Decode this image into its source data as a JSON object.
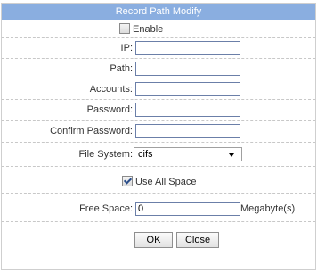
{
  "dialog": {
    "title": "Record Path Modify",
    "enable": {
      "label": "Enable",
      "checked": false
    },
    "ip": {
      "label": "IP:",
      "value": ""
    },
    "path": {
      "label": "Path:",
      "value": ""
    },
    "accounts": {
      "label": "Accounts:",
      "value": ""
    },
    "password": {
      "label": "Password:",
      "value": ""
    },
    "confirm_password": {
      "label": "Confirm Password:",
      "value": ""
    },
    "file_system": {
      "label": "File System:",
      "selected": "cifs"
    },
    "use_all_space": {
      "label": "Use All Space",
      "checked": true
    },
    "free_space": {
      "label": "Free Space:",
      "value": "0",
      "unit": "Megabyte(s)"
    },
    "buttons": {
      "ok": "OK",
      "close": "Close"
    }
  },
  "colors": {
    "titlebar": "#8aaee0",
    "field_border": "#6b7fa8",
    "row_divider": "#c8c8c8"
  }
}
